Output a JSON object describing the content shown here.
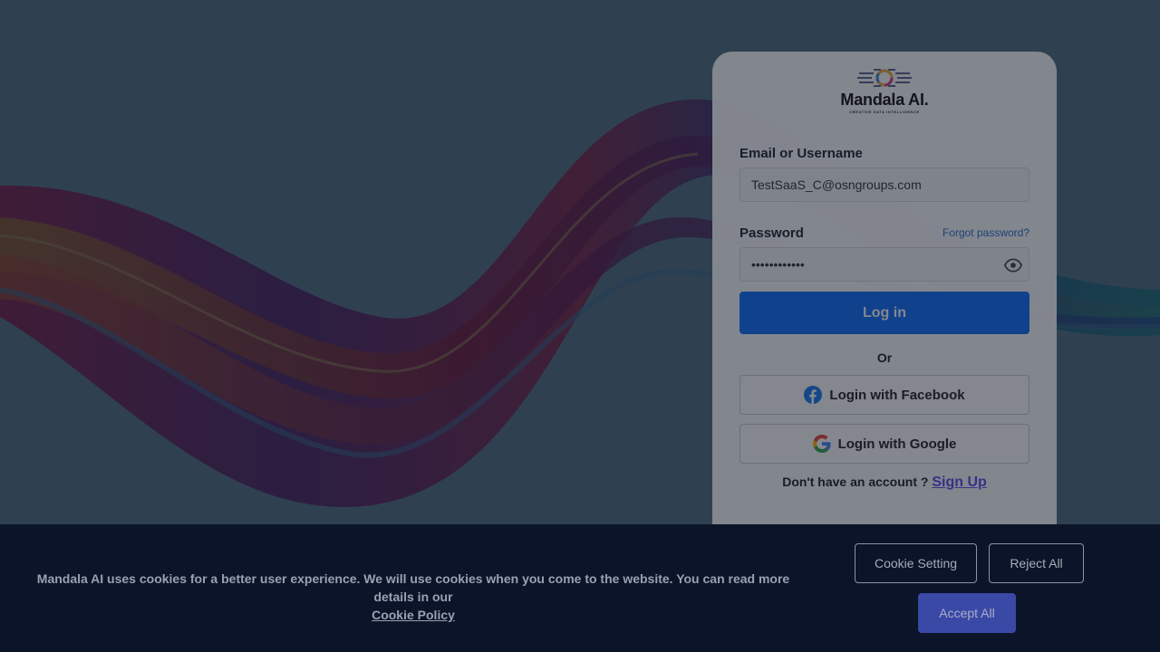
{
  "brand": {
    "name": "Mandala AI.",
    "tagline": "CREATIVE DATA INTELLIGENCE"
  },
  "login": {
    "email_label": "Email or Username",
    "email_value": "TestSaaS_C@osngroups.com",
    "password_label": "Password",
    "password_value": "••••••••••••",
    "forgot_label": "Forgot password?",
    "login_label": "Log in",
    "or_label": "Or",
    "facebook_label": "Login with Facebook",
    "google_label": "Login with Google",
    "no_account_text": "Don't have an account ?",
    "signup_label": "Sign Up"
  },
  "cookie": {
    "message": "Mandala AI uses cookies for a better user experience. We will use cookies when you come to the website. You can read more details in our",
    "policy_link": "Cookie Policy",
    "setting_label": "Cookie Setting",
    "reject_label": "Reject All",
    "accept_label": "Accept All"
  },
  "colors": {
    "primary": "#0d6efd",
    "banner_bg": "#0b1428",
    "accept_bg": "#3a48a6",
    "signup_link": "#5b4cf0"
  }
}
